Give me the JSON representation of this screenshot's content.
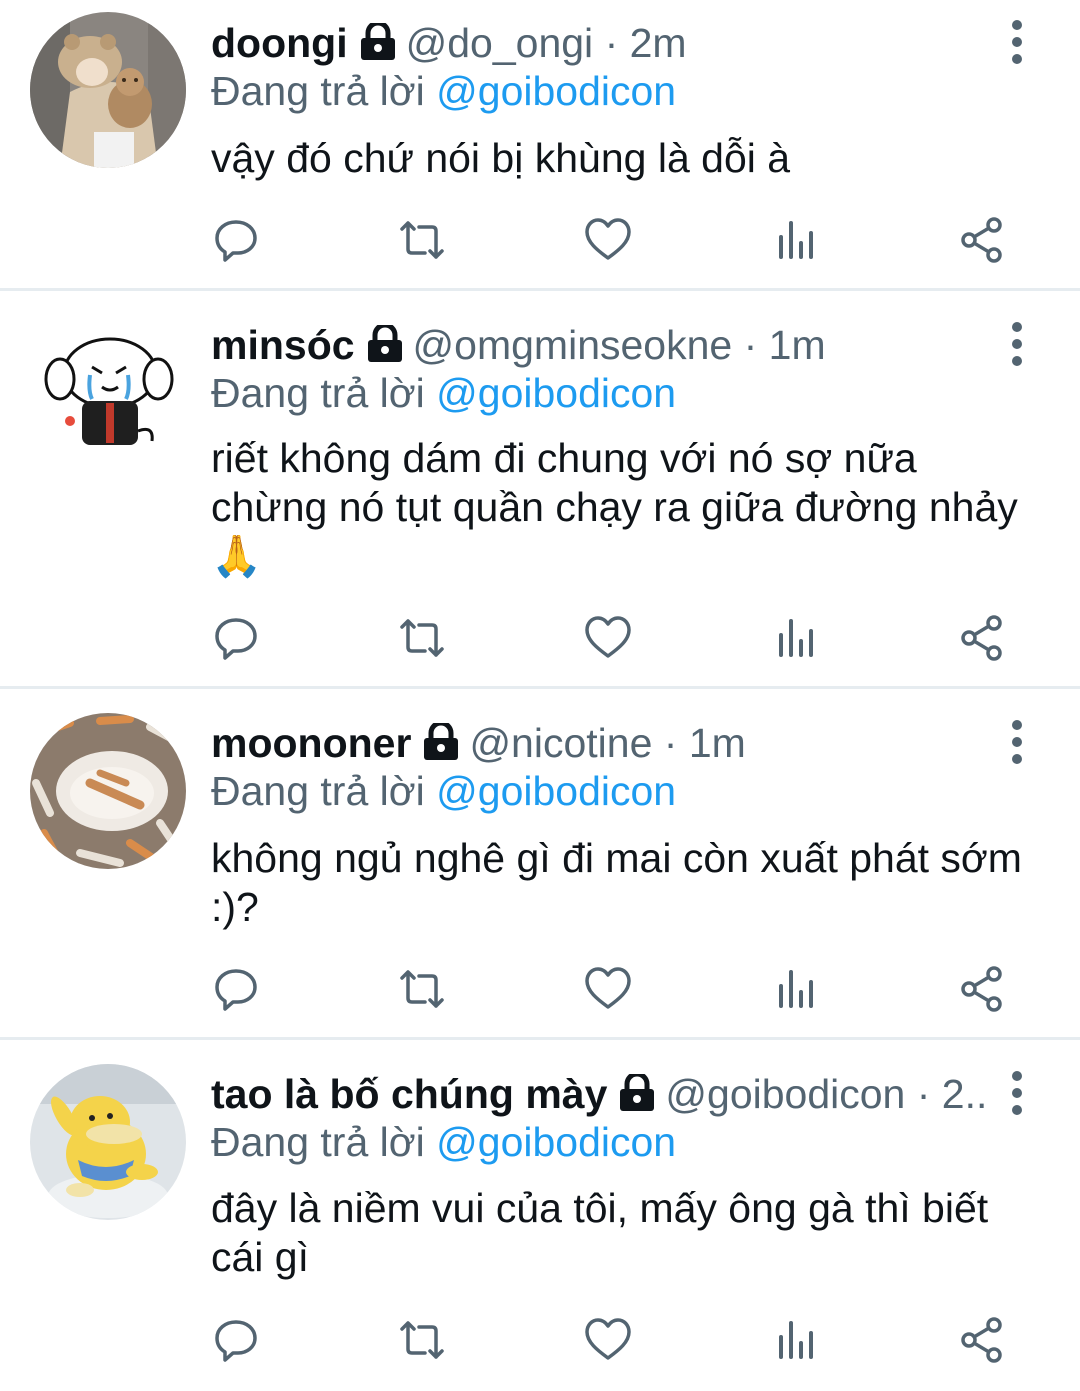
{
  "tweets": [
    {
      "name": "doongi",
      "handle": "@do_ongi",
      "time": "· 2m",
      "reply_prefix": "Đang trả lời",
      "reply_mention": "@goibodicon",
      "lines": [
        "vậy đó chứ nói bị khùng là dỗi à"
      ]
    },
    {
      "name": "minsóc",
      "handle": "@omgminseokne",
      "time": "· 1m",
      "reply_prefix": "Đang trả lời",
      "reply_mention": "@goibodicon",
      "lines": [
        "riết không dám đi chung với nó sợ nữa",
        "chừng nó tụt quần chạy ra giữa đường nhảy",
        "🙏"
      ]
    },
    {
      "name": "moononer",
      "handle": "@nicotine",
      "time": "· 1m",
      "reply_prefix": "Đang trả lời",
      "reply_mention": "@goibodicon",
      "lines": [
        "không ngủ nghê gì đi mai còn xuất phát sớm",
        ":)?"
      ]
    },
    {
      "name": "tao là bố chúng mày",
      "handle": "@goibodicon",
      "time": "· 2...",
      "reply_prefix": "Đang trả lời",
      "reply_mention": "@goibodicon",
      "lines": [
        "đây là niềm vui của tôi, mấy ông gà thì biết",
        "cái gì"
      ]
    }
  ],
  "icons": {
    "lock": "lock-icon",
    "more": "more-vertical-icon",
    "reply": "reply-icon",
    "retweet": "retweet-icon",
    "like": "heart-icon",
    "views": "views-bar-chart-icon",
    "share": "share-icon"
  },
  "colors": {
    "text": "#0f1419",
    "secondary": "#536471",
    "mention": "#1d9bf0",
    "divider": "#e6ecf0"
  }
}
